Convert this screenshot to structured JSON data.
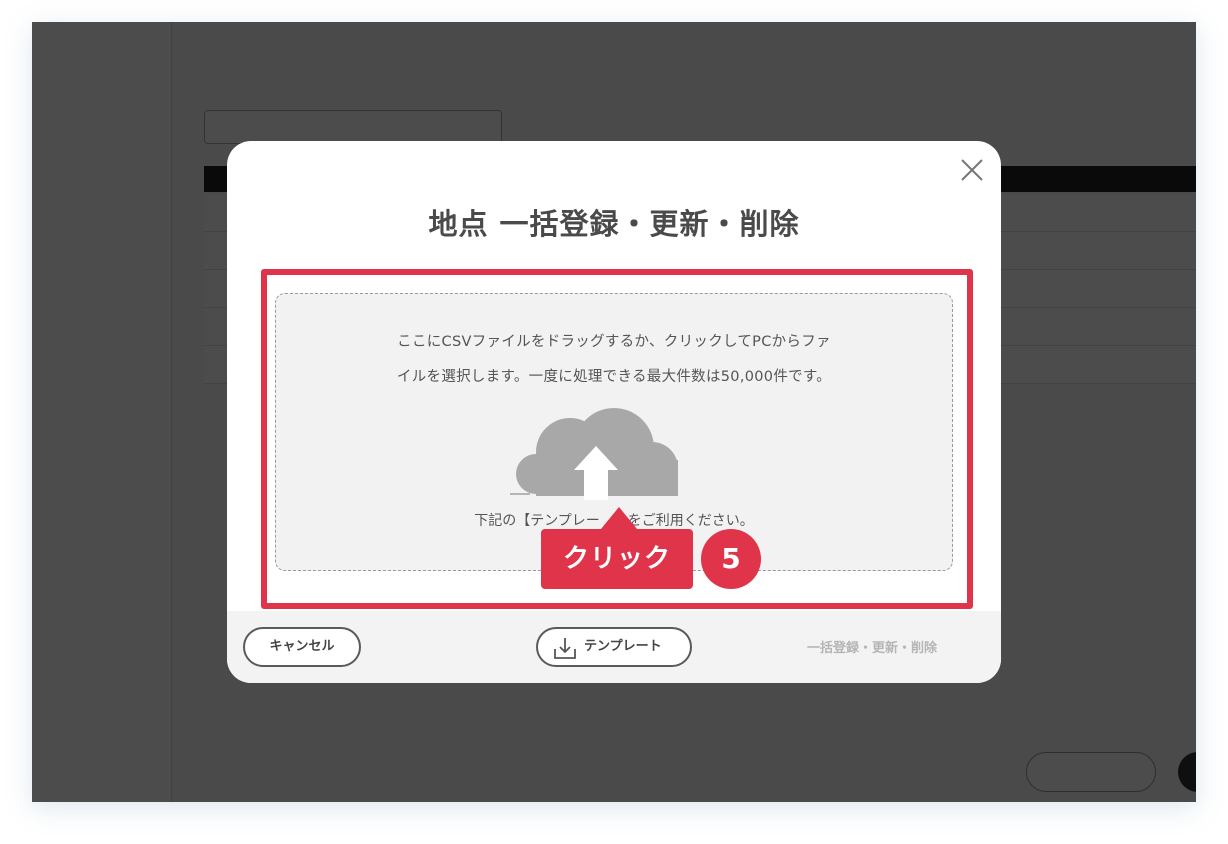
{
  "modal": {
    "title": "地点 一括登録・更新・削除",
    "drop_text_line1": "ここにCSVファイルをドラッグするか、クリックしてPCからファ",
    "drop_text_line2": "イルを選択します。一度に処理できる最大件数は50,000件です。",
    "template_note": "下記の【テンプレー　　をご利用ください。",
    "callout_label": "クリック",
    "step_number": "5",
    "cancel_label": "キャンセル",
    "template_label": "テンプレート",
    "submit_label": "一括登録・更新・削除"
  },
  "colors": {
    "accent": "#e0344a",
    "overlay": "rgba(0,0,0,0.70)",
    "cloud": "#a8a8a8",
    "disabled_text": "#b5b5b5"
  },
  "icons": [
    "close-icon",
    "cloud-upload-icon",
    "download-icon"
  ]
}
